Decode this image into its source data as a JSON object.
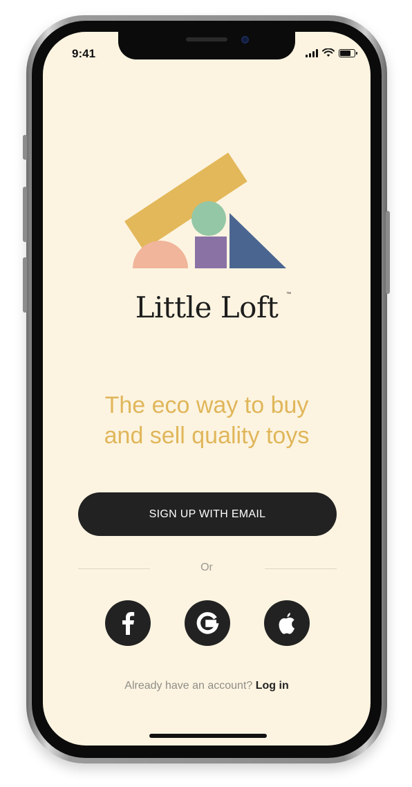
{
  "status_bar": {
    "time": "9:41",
    "battery_level": 0.85
  },
  "brand": {
    "name": "Little Loft",
    "trademark": "™"
  },
  "tagline": "The eco way to buy\nand sell quality toys",
  "signup_button": {
    "label": "SIGN UP WITH EMAIL"
  },
  "divider": {
    "label": "Or"
  },
  "social_logins": [
    {
      "icon": "facebook-icon"
    },
    {
      "icon": "google-icon"
    },
    {
      "icon": "apple-icon"
    }
  ],
  "login_prompt": {
    "text": "Already have an account?",
    "link_label": "Log in"
  },
  "colors": {
    "background": "#fcf4e1",
    "accent_yellow": "#e0b65a",
    "button_dark": "#222222",
    "shape_rect": "#e3b85a",
    "shape_circle": "#94c7a6",
    "shape_square": "#8a72a5",
    "shape_triangle": "#4a6590",
    "shape_semicircle": "#f0b59a"
  }
}
